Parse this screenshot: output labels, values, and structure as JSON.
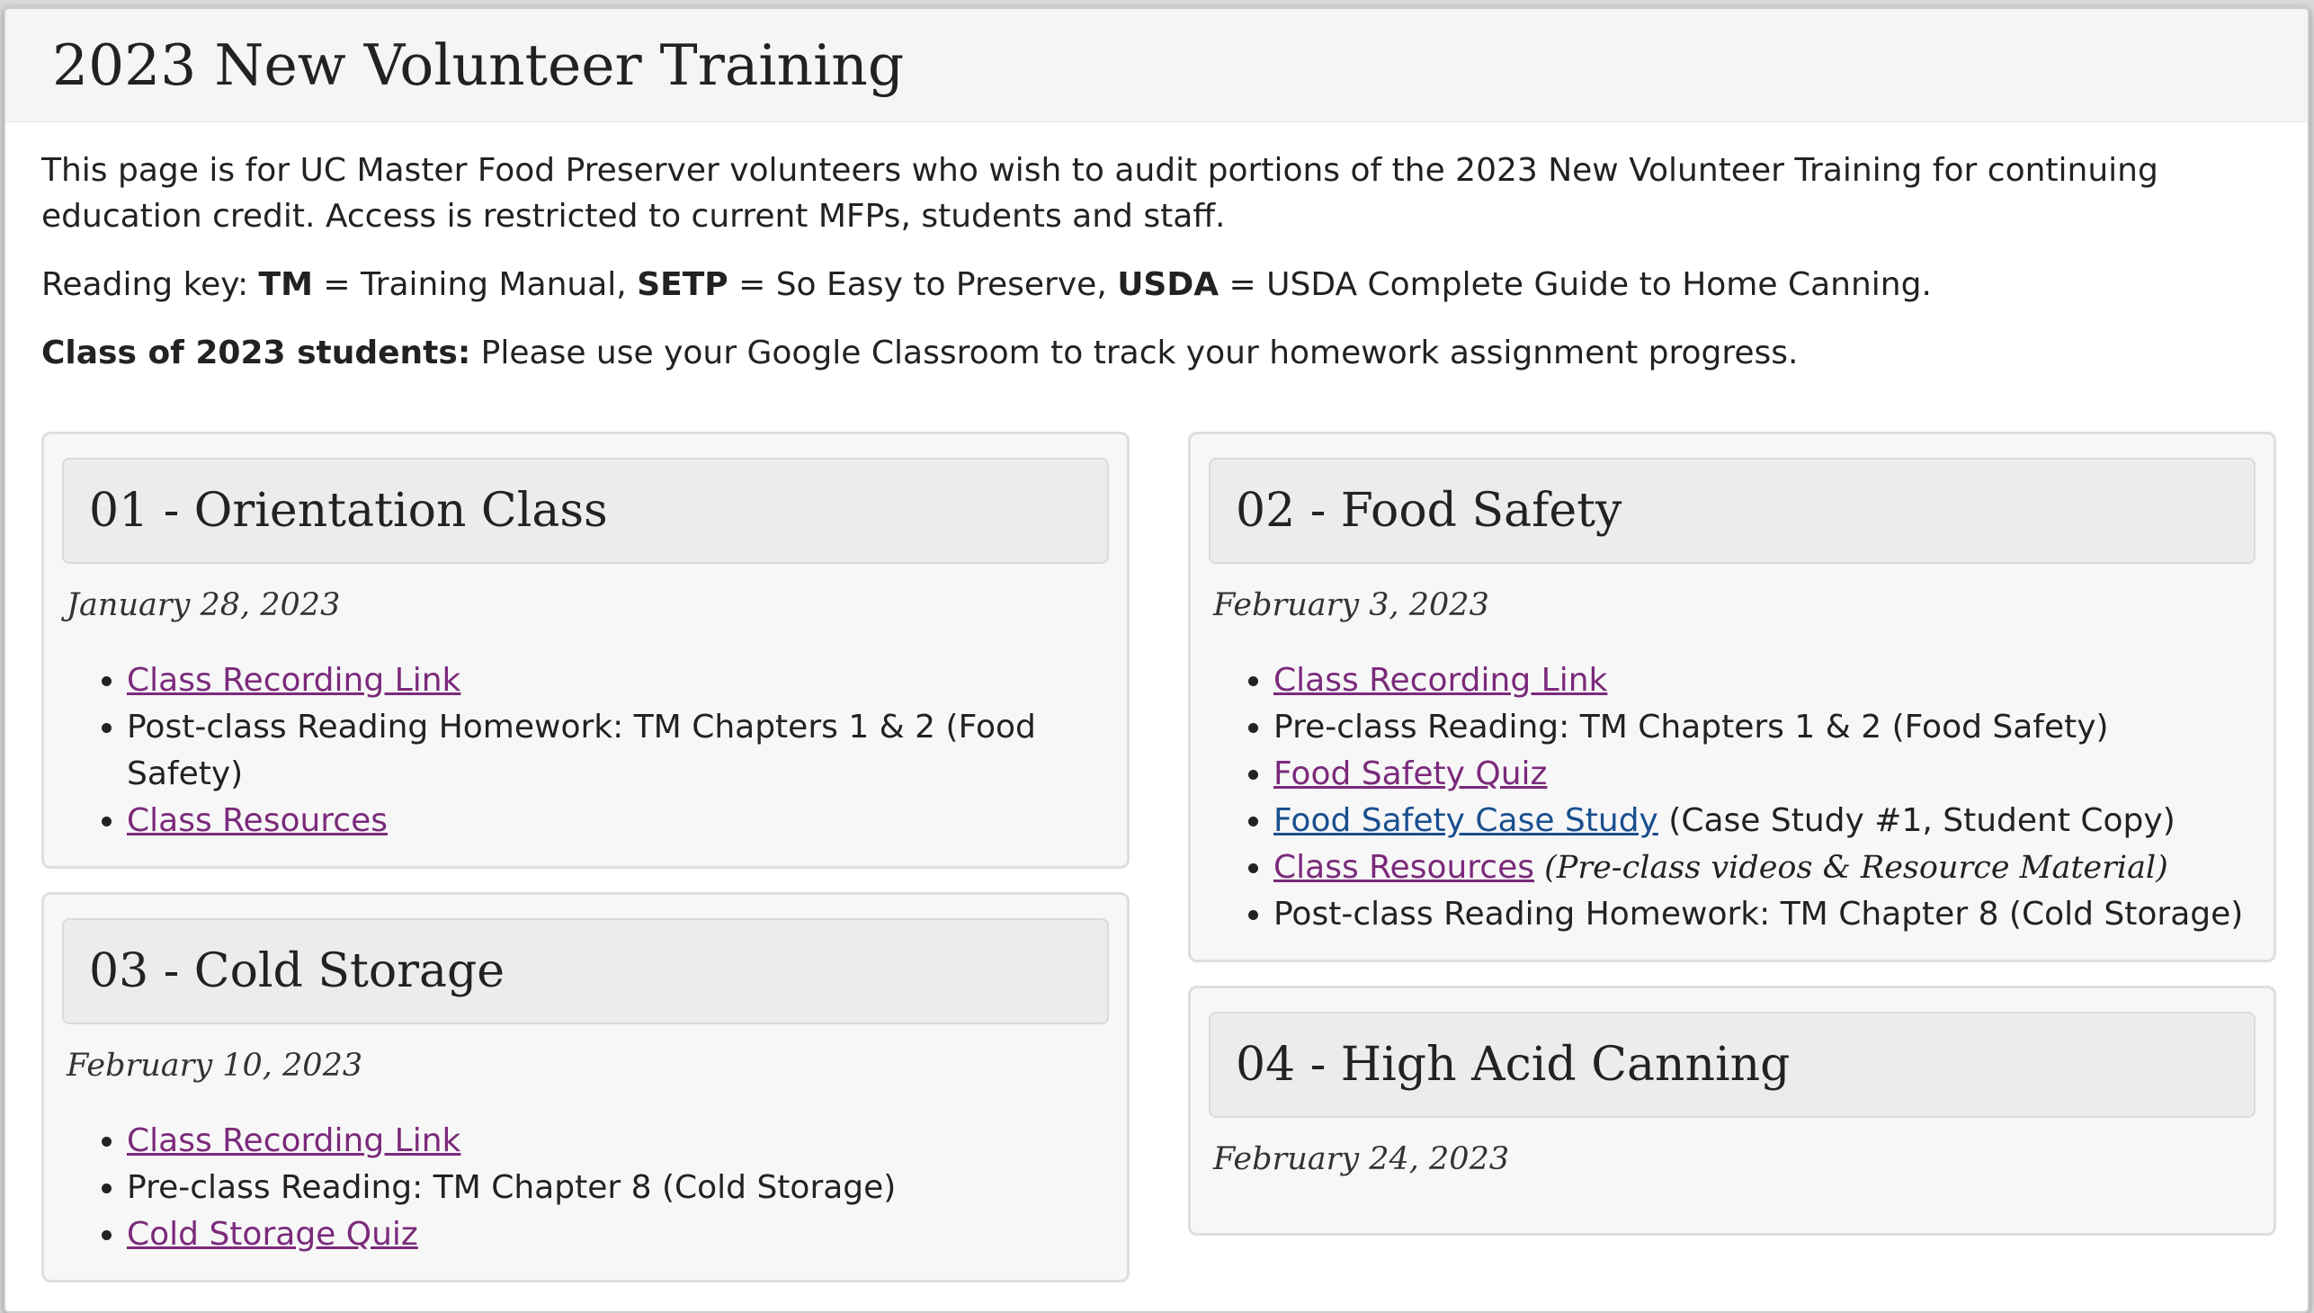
{
  "page": {
    "title": "2023 New Volunteer Training",
    "intro": "This page is for UC Master Food Preserver volunteers who wish to audit portions of the 2023 New Volunteer Training for continuing education credit. Access is restricted to current MFPs, students and staff.",
    "reading_key": {
      "prefix": "Reading key: ",
      "tm": "TM",
      "tm_text": " = Training Manual, ",
      "setp": "SETP",
      "setp_text": " = So Easy to Preserve, ",
      "usda": "USDA",
      "usda_text": " = USDA Complete Guide to Home Canning."
    },
    "students_note": {
      "bold": "Class of 2023 students:",
      "text": " Please use your Google Classroom to track your homework assignment progress."
    }
  },
  "classes": {
    "c01": {
      "title": "01 - Orientation Class",
      "date": "January 28, 2023",
      "recording": "Class Recording Link",
      "reading": "Post-class Reading Homework: TM Chapters 1 & 2 (Food Safety)",
      "resources": "Class Resources"
    },
    "c02": {
      "title": "02 - Food Safety",
      "date": "February 3, 2023",
      "recording": "Class Recording Link",
      "preread": "Pre-class Reading: TM Chapters 1 & 2 (Food Safety)",
      "quiz": "Food Safety Quiz",
      "case_study": "Food Safety Case Study",
      "case_study_note": " (Case Study #1, Student Copy)",
      "resources": "Class Resources",
      "resources_note": " (Pre-class videos & Resource Material)",
      "postread": "Post-class Reading Homework: TM Chapter 8 (Cold Storage)"
    },
    "c03": {
      "title": "03 - Cold Storage",
      "date": "February 10, 2023",
      "recording": "Class Recording Link",
      "preread": "Pre-class Reading: TM Chapter 8 (Cold Storage)",
      "quiz": "Cold Storage Quiz"
    },
    "c04": {
      "title": "04 - High Acid Canning",
      "date": "February 24, 2023"
    }
  },
  "colors": {
    "visited_link": "#7b2a7b",
    "link": "#1a4f8f",
    "card_bg": "#f7f7f7",
    "card_head_bg": "#ececec"
  }
}
